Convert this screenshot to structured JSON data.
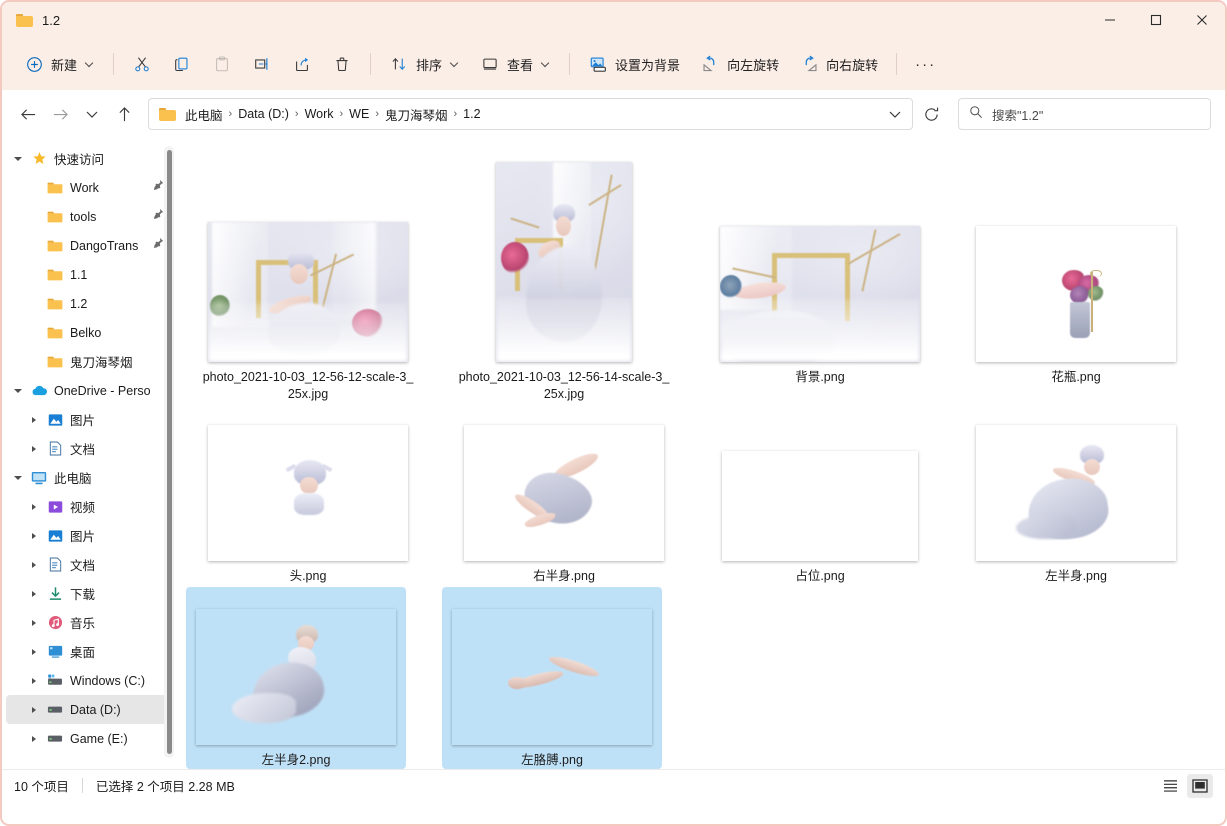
{
  "window": {
    "title": "1.2",
    "title_icon": "folder-icon",
    "controls": [
      {
        "name": "minimize-button",
        "glyph": "minimize-icon"
      },
      {
        "name": "maximize-button",
        "glyph": "maximize-icon"
      },
      {
        "name": "close-button",
        "glyph": "close-icon"
      }
    ]
  },
  "toolbar": {
    "new_label": "新建",
    "cut_label": "剪切",
    "copy_label": "复制",
    "paste_label": "粘贴",
    "rename_label": "重命名",
    "share_label": "共享",
    "delete_label": "删除",
    "sort_label": "排序",
    "view_label": "查看",
    "set_background_label": "设置为背景",
    "rotate_left_label": "向左旋转",
    "rotate_right_label": "向右旋转",
    "more_label": "···",
    "icons": {
      "new": "plus-circle-icon",
      "cut": "scissors-icon",
      "copy": "copy-icon",
      "paste": "paste-icon",
      "rename": "rename-icon",
      "share": "share-icon",
      "delete": "trash-icon",
      "sort": "sort-arrows-icon",
      "view": "monitor-icon",
      "set_background": "image-background-icon",
      "rotate_left": "rotate-left-icon",
      "rotate_right": "rotate-right-icon",
      "more": "ellipsis-icon"
    }
  },
  "addressbar": {
    "back_icon": "back-arrow-icon",
    "forward_icon": "forward-arrow-icon",
    "recent_icon": "chevron-down-icon",
    "up_icon": "up-arrow-icon",
    "refresh_icon": "refresh-icon",
    "dropdown_icon": "chevron-down-icon",
    "crumb_icon": "folder-icon",
    "breadcrumbs": [
      "此电脑",
      "Data (D:)",
      "Work",
      "WE",
      "鬼刀海琴烟",
      "1.2"
    ],
    "separator": "›"
  },
  "search": {
    "icon": "search-icon",
    "placeholder": "搜索\"1.2\""
  },
  "sidebar": {
    "scrollbar": "vertical-scrollbar",
    "items": [
      {
        "label": "快速访问",
        "icon": "star-icon",
        "expander": "down",
        "indent": 0,
        "pinned": false,
        "selected": false
      },
      {
        "label": "Work",
        "icon": "folder-icon",
        "expander": "none",
        "indent": 1,
        "pinned": true,
        "selected": false
      },
      {
        "label": "tools",
        "icon": "folder-icon",
        "expander": "none",
        "indent": 1,
        "pinned": true,
        "selected": false
      },
      {
        "label": "DangoTrans",
        "icon": "folder-icon",
        "expander": "none",
        "indent": 1,
        "pinned": true,
        "selected": false
      },
      {
        "label": "1.1",
        "icon": "folder-icon",
        "expander": "none",
        "indent": 1,
        "pinned": false,
        "selected": false
      },
      {
        "label": "1.2",
        "icon": "folder-icon",
        "expander": "none",
        "indent": 1,
        "pinned": false,
        "selected": false
      },
      {
        "label": "Belko",
        "icon": "folder-icon",
        "expander": "none",
        "indent": 1,
        "pinned": false,
        "selected": false
      },
      {
        "label": "鬼刀海琴烟",
        "icon": "folder-icon",
        "expander": "none",
        "indent": 1,
        "pinned": false,
        "selected": false
      },
      {
        "label": "OneDrive - Perso",
        "icon": "onedrive-cloud-icon",
        "expander": "down",
        "indent": 0,
        "pinned": false,
        "selected": false
      },
      {
        "label": "图片",
        "icon": "pictures-icon",
        "expander": "right",
        "indent": 1,
        "pinned": false,
        "selected": false
      },
      {
        "label": "文档",
        "icon": "documents-icon",
        "expander": "right",
        "indent": 1,
        "pinned": false,
        "selected": false
      },
      {
        "label": "此电脑",
        "icon": "this-pc-icon",
        "expander": "down",
        "indent": 0,
        "pinned": false,
        "selected": false
      },
      {
        "label": "视频",
        "icon": "videos-icon",
        "expander": "right",
        "indent": 1,
        "pinned": false,
        "selected": false
      },
      {
        "label": "图片",
        "icon": "pictures-icon",
        "expander": "right",
        "indent": 1,
        "pinned": false,
        "selected": false
      },
      {
        "label": "文档",
        "icon": "documents-icon",
        "expander": "right",
        "indent": 1,
        "pinned": false,
        "selected": false
      },
      {
        "label": "下载",
        "icon": "downloads-icon",
        "expander": "right",
        "indent": 1,
        "pinned": false,
        "selected": false
      },
      {
        "label": "音乐",
        "icon": "music-icon",
        "expander": "right",
        "indent": 1,
        "pinned": false,
        "selected": false
      },
      {
        "label": "桌面",
        "icon": "desktop-icon",
        "expander": "right",
        "indent": 1,
        "pinned": false,
        "selected": false
      },
      {
        "label": "Windows (C:)",
        "icon": "system-drive-icon",
        "expander": "right",
        "indent": 1,
        "pinned": false,
        "selected": false
      },
      {
        "label": "Data (D:)",
        "icon": "drive-icon",
        "expander": "right",
        "indent": 1,
        "pinned": false,
        "selected": true
      },
      {
        "label": "Game (E:)",
        "icon": "drive-icon",
        "expander": "right",
        "indent": 1,
        "pinned": false,
        "selected": false
      }
    ]
  },
  "files": [
    {
      "name": "photo_2021-10-03_12-56-12-scale-3_25x.jpg",
      "thumb_w": 200,
      "thumb_h": 140,
      "kind": "photo-landscape",
      "selected": false
    },
    {
      "name": "photo_2021-10-03_12-56-14-scale-3_25x.jpg",
      "thumb_w": 136,
      "thumb_h": 200,
      "kind": "photo-portrait",
      "selected": false
    },
    {
      "name": "背景.png",
      "thumb_w": 200,
      "thumb_h": 136,
      "kind": "background",
      "selected": false
    },
    {
      "name": "花瓶.png",
      "thumb_w": 200,
      "thumb_h": 136,
      "kind": "vase",
      "selected": false
    },
    {
      "name": "头.png",
      "thumb_w": 200,
      "thumb_h": 136,
      "kind": "head",
      "selected": false
    },
    {
      "name": "右半身.png",
      "thumb_w": 200,
      "thumb_h": 136,
      "kind": "right-body",
      "selected": false
    },
    {
      "name": "占位.png",
      "thumb_w": 196,
      "thumb_h": 110,
      "kind": "placeholder",
      "selected": false
    },
    {
      "name": "左半身.png",
      "thumb_w": 200,
      "thumb_h": 136,
      "kind": "left-body",
      "selected": false
    },
    {
      "name": "左半身2.png",
      "thumb_w": 200,
      "thumb_h": 136,
      "kind": "left-body-2",
      "selected": true
    },
    {
      "name": "左胳膊.png",
      "thumb_w": 200,
      "thumb_h": 136,
      "kind": "left-arm",
      "selected": true
    }
  ],
  "statusbar": {
    "item_count": "10 个项目",
    "selection": "已选择 2 个项目  2.28 MB",
    "views": [
      {
        "name": "details-view-button",
        "icon": "list-view-icon",
        "active": false
      },
      {
        "name": "large-icons-view-button",
        "icon": "large-icons-view-icon",
        "active": true
      }
    ]
  },
  "colors": {
    "titlebar_bg": "#fbeee7",
    "window_border": "#f3c9c0",
    "selection_blue": "#bfe1f7",
    "accent_blue": "#0a6cbd",
    "folder_yellow": "#fbc14f",
    "text": "#1b1b1b"
  }
}
